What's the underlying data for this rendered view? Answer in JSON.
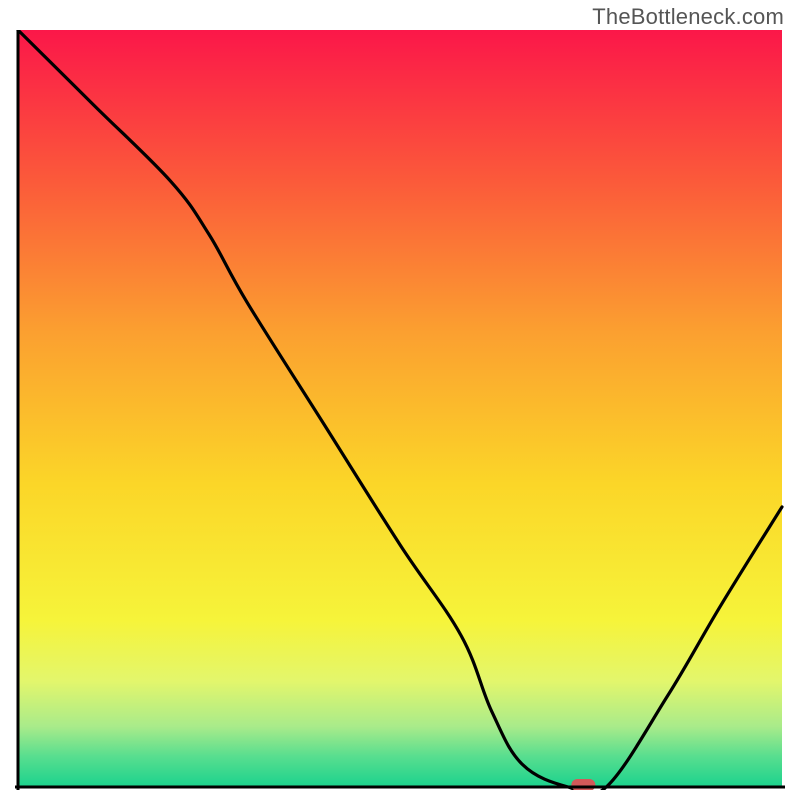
{
  "watermark": "TheBottleneck.com",
  "chart_data": {
    "type": "line",
    "title": "",
    "xlabel": "",
    "ylabel": "",
    "xlim": [
      0,
      100
    ],
    "ylim": [
      0,
      100
    ],
    "grid": false,
    "legend": false,
    "series": [
      {
        "name": "bottleneck-curve",
        "x": [
          0,
          10,
          20,
          25,
          30,
          40,
          50,
          58,
          62,
          66,
          72,
          77,
          85,
          92,
          100
        ],
        "values": [
          100,
          90,
          80,
          73,
          64,
          48,
          32,
          20,
          10,
          3,
          0,
          0,
          12,
          24,
          37
        ]
      }
    ],
    "marker": {
      "x": 74,
      "y": 0
    },
    "background_gradient": {
      "type": "vertical",
      "stops": [
        {
          "offset": 0.0,
          "color": "#fb1749"
        },
        {
          "offset": 0.2,
          "color": "#fb5a3a"
        },
        {
          "offset": 0.4,
          "color": "#fba030"
        },
        {
          "offset": 0.6,
          "color": "#fbd628"
        },
        {
          "offset": 0.78,
          "color": "#f6f43a"
        },
        {
          "offset": 0.86,
          "color": "#e3f66c"
        },
        {
          "offset": 0.92,
          "color": "#a9eb8a"
        },
        {
          "offset": 0.96,
          "color": "#57de8f"
        },
        {
          "offset": 1.0,
          "color": "#1bd28d"
        }
      ]
    }
  }
}
